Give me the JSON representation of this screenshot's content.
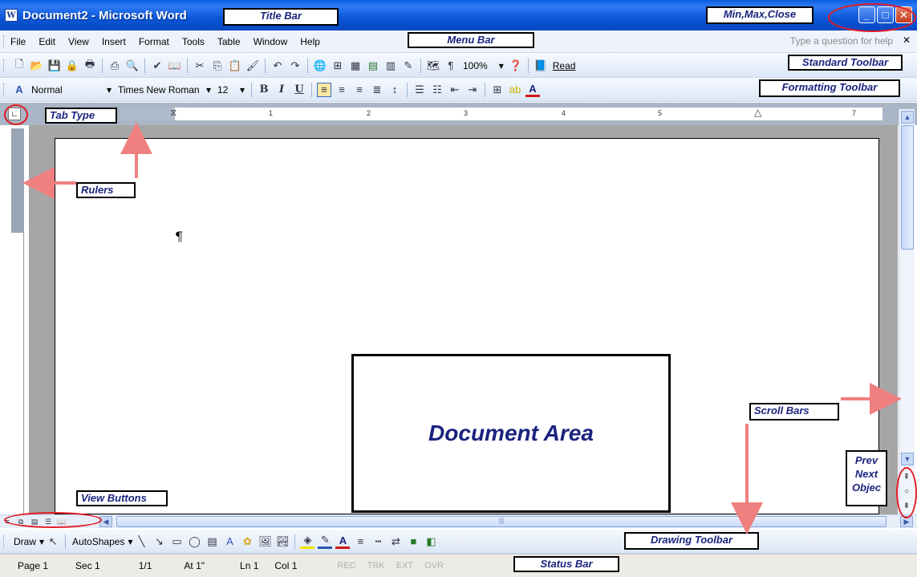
{
  "window": {
    "title": "Document2 - Microsoft Word",
    "app_icon": "word-icon",
    "minimize": "_",
    "maximize": "□",
    "close": "✕"
  },
  "menu": {
    "items": [
      "File",
      "Edit",
      "View",
      "Insert",
      "Format",
      "Tools",
      "Table",
      "Window",
      "Help"
    ],
    "help_placeholder": "Type a question for help",
    "close_doc": "✕"
  },
  "standard_toolbar": {
    "zoom": "100%",
    "read_label": "Read"
  },
  "formatting_toolbar": {
    "style": "Normal",
    "font": "Times New Roman",
    "size": "12",
    "bold": "B",
    "italic": "I",
    "underline": "U"
  },
  "ruler": {
    "numbers": [
      "1",
      "2",
      "3",
      "4",
      "5",
      "7"
    ]
  },
  "document": {
    "pilcrow": "¶"
  },
  "drawing_toolbar": {
    "draw_label": "Draw",
    "autoshapes_label": "AutoShapes"
  },
  "status_bar": {
    "page": "Page 1",
    "sec": "Sec 1",
    "pages": "1/1",
    "at": "At 1\"",
    "ln": "Ln 1",
    "col": "Col 1",
    "rec": "REC",
    "trk": "TRK",
    "ext": "EXT",
    "ovr": "OVR"
  },
  "callouts": {
    "title_bar": "Title Bar",
    "min_max_close": "Min,Max,Close",
    "menu_bar": "Menu Bar",
    "standard_toolbar": "Standard Toolbar",
    "formatting_toolbar": "Formatting Toolbar",
    "tab_type": "Tab Type",
    "rulers": "Rulers",
    "document_area": "Document Area",
    "scroll_bars": "Scroll Bars",
    "prev_next": "Prev Next Objec",
    "view_buttons": "View Buttons",
    "drawing_toolbar": "Drawing Toolbar",
    "status_bar": "Status Bar"
  },
  "colors": {
    "titlebar": "#0b56d6",
    "callout_text": "#1a237e",
    "highlight_ring": "#e31b23",
    "arrow": "#f08080"
  }
}
